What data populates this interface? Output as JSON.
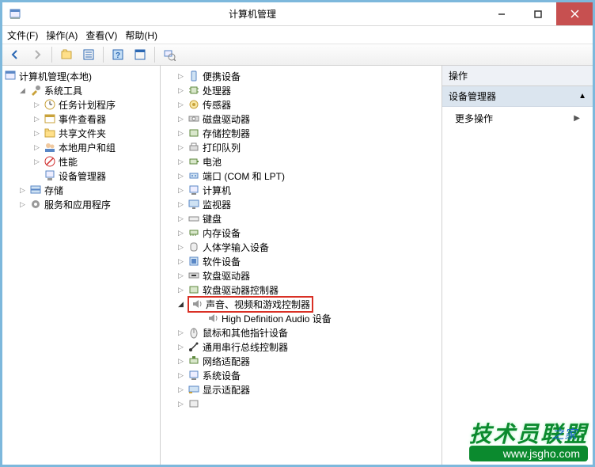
{
  "window": {
    "title": "计算机管理"
  },
  "menu": {
    "file": "文件(F)",
    "action": "操作(A)",
    "view": "查看(V)",
    "help": "帮助(H)"
  },
  "left_tree": {
    "root": "计算机管理(本地)",
    "system_tools": "系统工具",
    "task_scheduler": "任务计划程序",
    "event_viewer": "事件查看器",
    "shared_folders": "共享文件夹",
    "local_users": "本地用户和组",
    "performance": "性能",
    "device_manager": "设备管理器",
    "storage": "存储",
    "services": "服务和应用程序"
  },
  "mid_tree": {
    "portable": "便携设备",
    "cpu": "处理器",
    "sensor": "传感器",
    "disk": "磁盘驱动器",
    "storage_ctrl": "存储控制器",
    "print_queue": "打印队列",
    "battery": "电池",
    "com_lpt": "端口 (COM 和 LPT)",
    "computer": "计算机",
    "monitor": "监视器",
    "keyboard": "键盘",
    "memory": "内存设备",
    "hid": "人体学输入设备",
    "software_dev": "软件设备",
    "floppy": "软盘驱动器",
    "floppy_ctrl": "软盘驱动器控制器",
    "sound": "声音、视频和游戏控制器",
    "hd_audio": "High Definition Audio 设备",
    "mouse": "鼠标和其他指针设备",
    "usb": "通用串行总线控制器",
    "network": "网络适配器",
    "sys_dev": "系统设备",
    "display": "显示适配器"
  },
  "right": {
    "header": "操作",
    "category": "设备管理器",
    "more_actions": "更多操作"
  },
  "watermark": {
    "big": "技术员联盟",
    "url": "www.jsgho.com",
    "other": "之家"
  }
}
